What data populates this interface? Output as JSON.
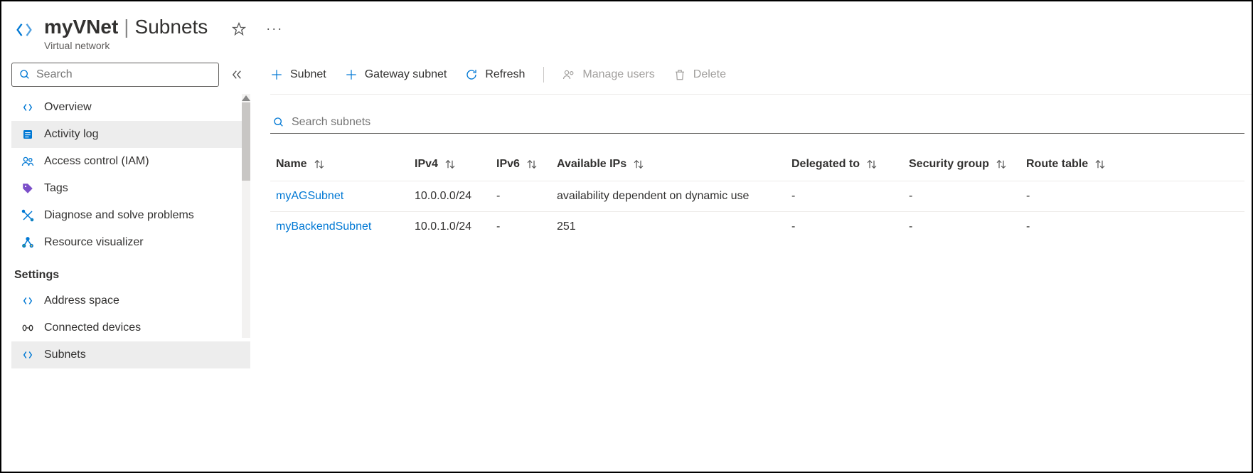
{
  "header": {
    "resource_name": "myVNet",
    "page_name": "Subnets",
    "resource_type": "Virtual network"
  },
  "sidebar": {
    "search_placeholder": "Search",
    "items": [
      {
        "label": "Overview"
      },
      {
        "label": "Activity log"
      },
      {
        "label": "Access control (IAM)"
      },
      {
        "label": "Tags"
      },
      {
        "label": "Diagnose and solve problems"
      },
      {
        "label": "Resource visualizer"
      }
    ],
    "settings_label": "Settings",
    "settings_items": [
      {
        "label": "Address space"
      },
      {
        "label": "Connected devices"
      },
      {
        "label": "Subnets"
      }
    ]
  },
  "toolbar": {
    "subnet": "Subnet",
    "gateway_subnet": "Gateway subnet",
    "refresh": "Refresh",
    "manage_users": "Manage users",
    "delete": "Delete"
  },
  "subnet_search_placeholder": "Search subnets",
  "table": {
    "headers": {
      "name": "Name",
      "ipv4": "IPv4",
      "ipv6": "IPv6",
      "available": "Available IPs",
      "delegated": "Delegated to",
      "security": "Security group",
      "route": "Route table"
    },
    "rows": [
      {
        "name": "myAGSubnet",
        "ipv4": "10.0.0.0/24",
        "ipv6": "-",
        "available": "availability dependent on dynamic use",
        "delegated": "-",
        "security": "-",
        "route": "-"
      },
      {
        "name": "myBackendSubnet",
        "ipv4": "10.0.1.0/24",
        "ipv6": "-",
        "available": "251",
        "delegated": "-",
        "security": "-",
        "route": "-"
      }
    ]
  }
}
